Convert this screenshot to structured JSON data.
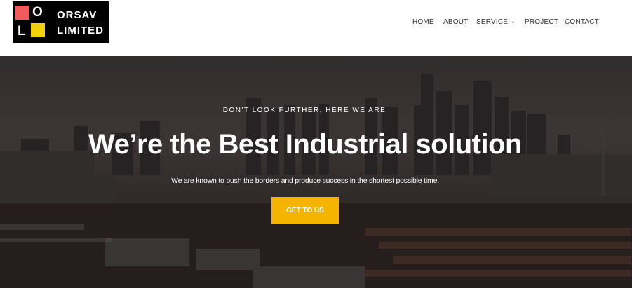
{
  "brand": {
    "logo_letter_top": "O",
    "logo_letter_bottom": "L",
    "name_line1": "ORSAV",
    "name_line2": "LIMITED",
    "colors": {
      "red": "#f25b5b",
      "yellow": "#f4d20a",
      "logo_bg": "#000000"
    }
  },
  "nav": {
    "items": [
      {
        "label": "HOME"
      },
      {
        "label": "ABOUT"
      },
      {
        "label": "SERVICE",
        "icon": "chevron-down-icon"
      },
      {
        "label": "PROJECT"
      },
      {
        "label": "CONTACT"
      }
    ]
  },
  "hero": {
    "eyebrow": "DON'T LOOK FURTHER, HERE WE ARE",
    "headline": "We’re the Best Industrial solution",
    "subtext": "We are known to push the borders and produce success in the shortest possible time.",
    "cta_label": "GET TO US",
    "cta_color": "#f4b400"
  }
}
